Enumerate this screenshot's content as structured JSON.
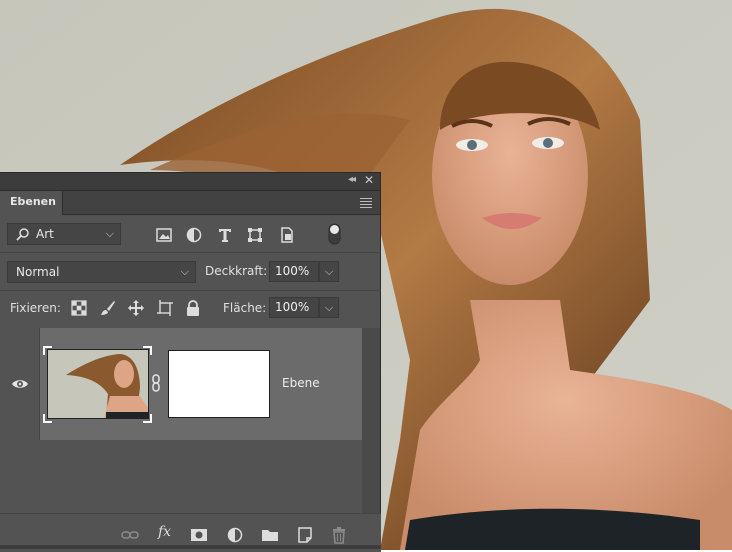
{
  "panel": {
    "tab_label": "Ebenen",
    "collapse_glyph": "◂◂",
    "close_glyph": "✕",
    "filter": {
      "label": "Art",
      "icons": [
        "image-filter-icon",
        "adjustment-filter-icon",
        "type-filter-icon",
        "shape-filter-icon",
        "smart-object-filter-icon"
      ]
    },
    "blend_mode": "Normal",
    "opacity": {
      "label": "Deckkraft:",
      "value": "100%"
    },
    "lock": {
      "label": "Fixieren:",
      "icons": [
        "lock-transparent-pixels-icon",
        "lock-image-pixels-icon",
        "lock-position-icon",
        "lock-artboard-icon",
        "lock-all-icon"
      ]
    },
    "fill": {
      "label": "Fläche:",
      "value": "100%"
    },
    "layers": [
      {
        "name": "Ebene",
        "visible": true,
        "has_mask": true,
        "linked": true
      }
    ],
    "footer_icons": [
      "link-layers-icon",
      "fx-icon",
      "add-mask-icon",
      "adjustment-layer-icon",
      "new-group-icon",
      "new-layer-icon",
      "delete-layer-icon"
    ],
    "footer_fx_label": "fx"
  },
  "colors": {
    "panel_bg": "#535353",
    "selected_layer": "#6b6b6b",
    "photo_bg": "#c8c8bd"
  }
}
